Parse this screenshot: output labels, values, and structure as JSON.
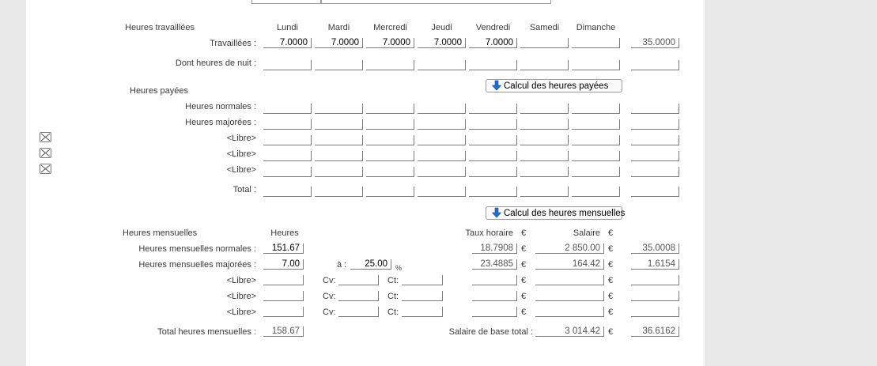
{
  "worked": {
    "title": "Heures travaillées",
    "days": [
      "Lundi",
      "Mardi",
      "Mercredi",
      "Jeudi",
      "Vendredi",
      "Samedi",
      "Dimanche"
    ],
    "rows": [
      {
        "label": "Travaillées :",
        "values": [
          "7.0000",
          "7.0000",
          "7.0000",
          "7.0000",
          "7.0000",
          "",
          ""
        ],
        "total": "35.0000"
      },
      {
        "label": "Dont heures de nuit :",
        "values": [
          "",
          "",
          "",
          "",
          "",
          "",
          ""
        ],
        "total": ""
      }
    ]
  },
  "paid": {
    "title": "Heures payées",
    "calc_button": "Calcul des heures payées",
    "rows": [
      {
        "label": "Heures normales :"
      },
      {
        "label": "Heures majorées :"
      },
      {
        "label": "<Libre>"
      },
      {
        "label": "<Libre>"
      },
      {
        "label": "<Libre>"
      },
      {
        "label": "Total :"
      }
    ]
  },
  "monthly": {
    "calc_button": "Calcul des heures mensuelles",
    "title": "Heures mensuelles",
    "hours_header": "Heures",
    "rate_header": "Taux horaire",
    "salary_header": "Salaire",
    "currency": "€",
    "a_label": "à :",
    "percent": "%",
    "cv_label": "Cv:",
    "ct_label": "Ct:",
    "rows": [
      {
        "label": "Heures mensuelles normales :",
        "hours": "151.67",
        "rate": "18.7908",
        "salary": "2 850.00",
        "extra": "35.0008"
      },
      {
        "label": "Heures mensuelles majorées :",
        "hours": "7.00",
        "pct": "25.00",
        "rate": "23.4885",
        "salary": "164.42",
        "extra": "1.6154"
      },
      {
        "label": "<Libre>",
        "hours": "",
        "rate": "",
        "salary": "",
        "extra": ""
      },
      {
        "label": "<Libre>",
        "hours": "",
        "rate": "",
        "salary": "",
        "extra": ""
      },
      {
        "label": "<Libre>",
        "hours": "",
        "rate": "",
        "salary": "",
        "extra": ""
      }
    ],
    "total_label": "Total heures mensuelles :",
    "total_hours": "158.67",
    "base_salary_label": "Salaire de base total :",
    "base_salary": "3 014.42",
    "base_extra": "36.6162"
  },
  "colors": {
    "accent": "#1f6fd0",
    "background": "#e9e9e9",
    "panel": "#ffffff"
  }
}
